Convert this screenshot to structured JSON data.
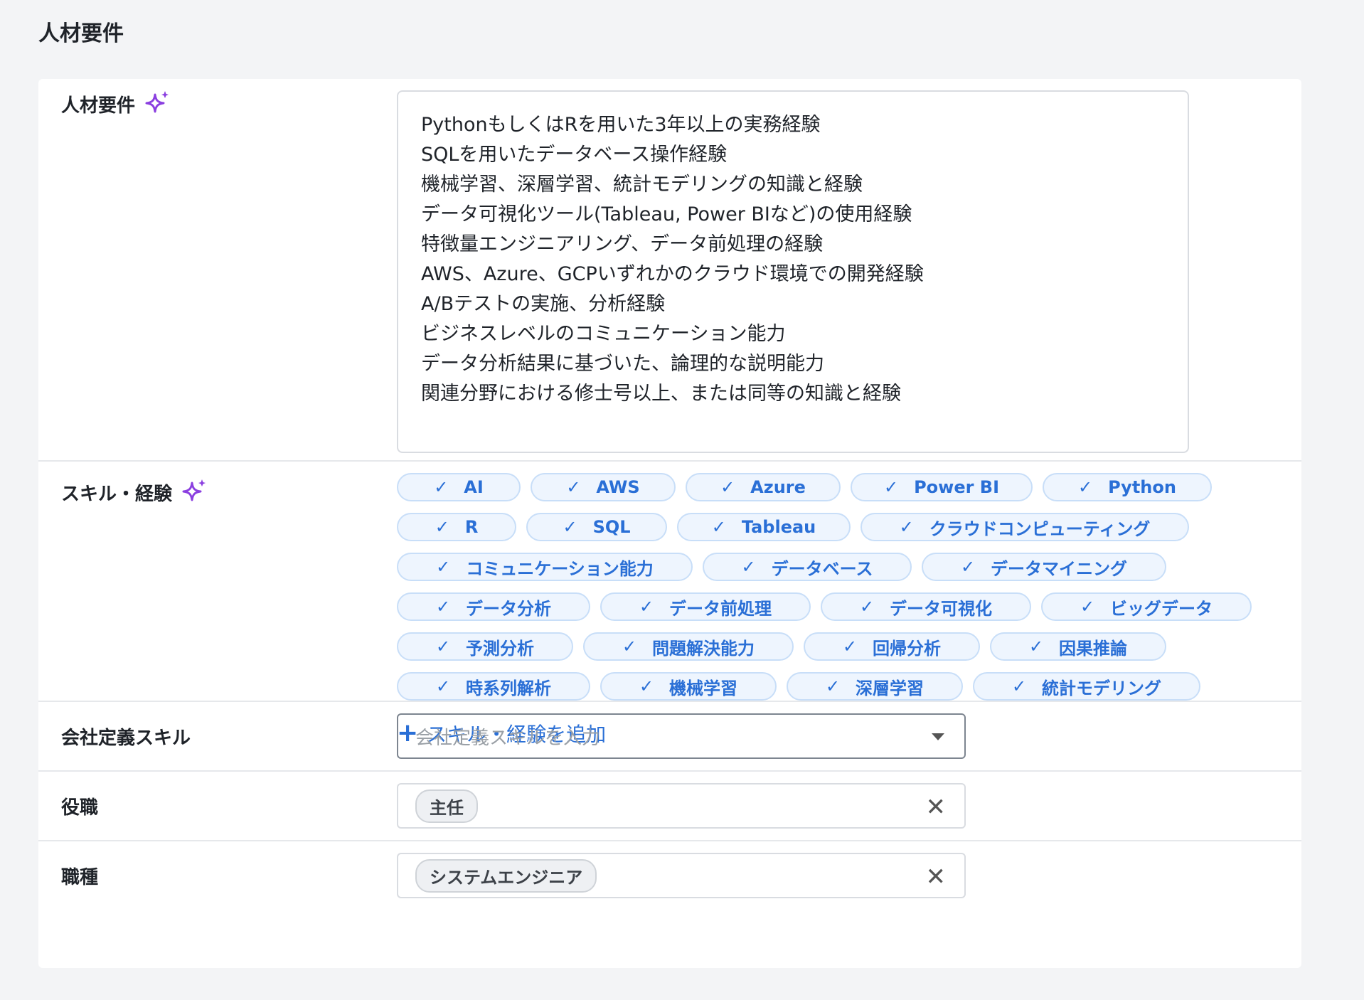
{
  "page": {
    "title": "人材要件"
  },
  "requirements": {
    "label": "人材要件",
    "lines": [
      "PythonもしくはRを用いた3年以上の実務経験",
      "SQLを用いたデータベース操作経験",
      "機械学習、深層学習、統計モデリングの知識と経験",
      "データ可視化ツール(Tableau, Power BIなど)の使用経験",
      "特徴量エンジニアリング、データ前処理の経験",
      "AWS、Azure、GCPいずれかのクラウド環境での開発経験",
      "A/Bテストの実施、分析経験",
      "ビジネスレベルのコミュニケーション能力",
      "データ分析結果に基づいた、論理的な説明能力",
      "関連分野における修士号以上、または同等の知識と経験"
    ]
  },
  "skills": {
    "label": "スキル・経験",
    "check_glyph": "✓",
    "rows": [
      [
        "AI",
        "AWS",
        "Azure",
        "Power BI",
        "Python"
      ],
      [
        "R",
        "SQL",
        "Tableau",
        "クラウドコンピューティング"
      ],
      [
        "コミュニケーション能力",
        "データベース",
        "データマイニング"
      ],
      [
        "データ分析",
        "データ前処理",
        "データ可視化",
        "ビッグデータ"
      ],
      [
        "予測分析",
        "問題解決能力",
        "回帰分析",
        "因果推論"
      ],
      [
        "時系列解析",
        "機械学習",
        "深層学習",
        "統計モデリング"
      ]
    ],
    "add_label": "スキル・経験を追加"
  },
  "company_skill": {
    "label": "会社定義スキル",
    "placeholder": "会社定義スキルを入力"
  },
  "position": {
    "label": "役職",
    "value": "主任"
  },
  "job_type": {
    "label": "職種",
    "value": "システムエンジニア"
  },
  "colors": {
    "accent": "#2a6fd6",
    "sparkle": "#8b3fe0",
    "chip_bg": "#eef5fe"
  }
}
